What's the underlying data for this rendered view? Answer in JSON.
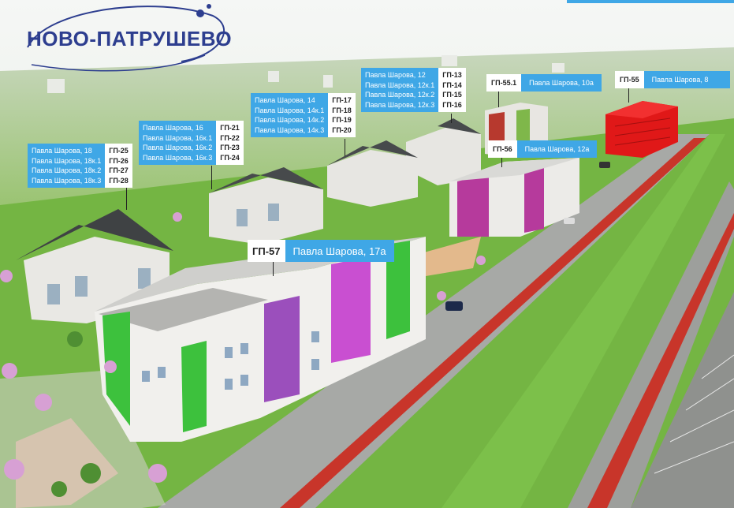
{
  "logo": {
    "text": "НОВО-ПАТРУШЕВО"
  },
  "callouts": {
    "gp25_28": {
      "addresses": [
        "Павла Шарова, 18",
        "Павла Шарова, 18к.1",
        "Павла Шарова, 18к.2",
        "Павла Шарова, 18к.3"
      ],
      "codes": [
        "ГП-25",
        "ГП-26",
        "ГП-27",
        "ГП-28"
      ]
    },
    "gp21_24": {
      "addresses": [
        "Павла Шарова, 16",
        "Павла Шарова, 16к.1",
        "Павла Шарова, 16к.2",
        "Павла Шарова, 16к.3"
      ],
      "codes": [
        "ГП-21",
        "ГП-22",
        "ГП-23",
        "ГП-24"
      ]
    },
    "gp17_20": {
      "addresses": [
        "Павла Шарова, 14",
        "Павла Шарова, 14к.1",
        "Павла Шарова, 14к.2",
        "Павла Шарова, 14к.3"
      ],
      "codes": [
        "ГП-17",
        "ГП-18",
        "ГП-19",
        "ГП-20"
      ]
    },
    "gp13_16": {
      "addresses": [
        "Павла Шарова, 12",
        "Павла Шарова, 12к.1",
        "Павла Шарова, 12к.2",
        "Павла Шарова, 12к.3"
      ],
      "codes": [
        "ГП-13",
        "ГП-14",
        "ГП-15",
        "ГП-16"
      ]
    }
  },
  "singles": {
    "gp55_1": {
      "code": "ГП-55.1",
      "address": "Павла Шарова, 10а"
    },
    "gp55": {
      "code": "ГП-55",
      "address": "Павла Шарова, 8"
    },
    "gp56": {
      "code": "ГП-56",
      "address": "Павла Шарова, 12а"
    },
    "gp57": {
      "code": "ГП-57",
      "address": "Павла Шарова, 17а"
    }
  },
  "colors": {
    "accent_blue": "#3fa7e6",
    "logo_navy": "#2d3e8f",
    "highlight_red": "#e01818",
    "road_red": "#c8352a",
    "grass": "#6fb83a"
  }
}
